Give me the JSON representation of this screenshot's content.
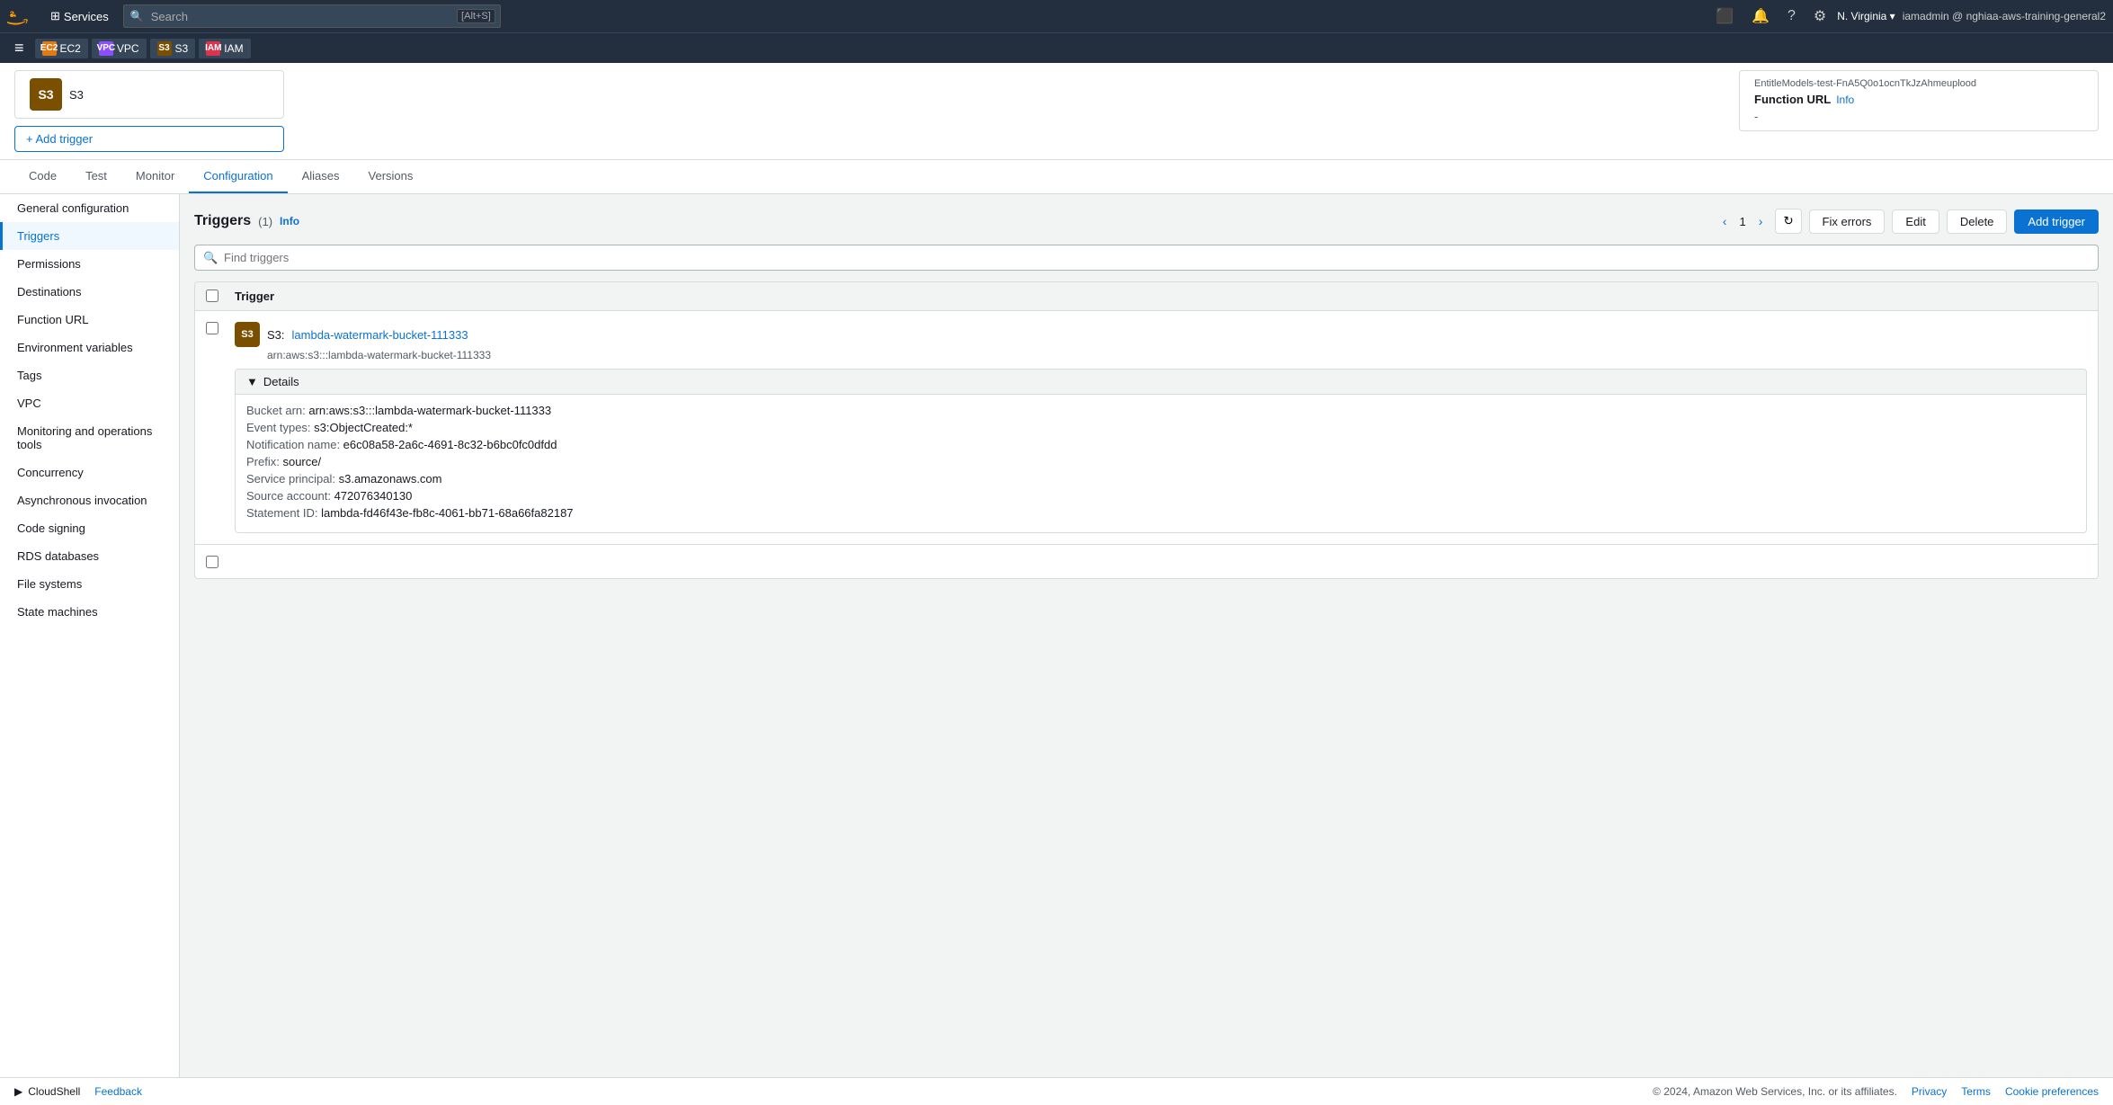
{
  "topNav": {
    "searchPlaceholder": "Search",
    "searchShortcut": "[Alt+S]",
    "servicesLabel": "Services",
    "userRegion": "N. Virginia",
    "userAccount": "iamadmin @ nghiaa-aws-training-general2"
  },
  "serviceBar": {
    "chips": [
      {
        "label": "EC2",
        "color": "#e47911"
      },
      {
        "label": "VPC",
        "color": "#8c4fff"
      },
      {
        "label": "S3",
        "color": "#7b4f00"
      },
      {
        "label": "IAM",
        "color": "#dd344c"
      }
    ]
  },
  "topPanel": {
    "s3Label": "S3",
    "addTriggerBtn": "+ Add trigger",
    "functionUrlLabel": "Function URL",
    "functionUrlInfo": "Info",
    "functionUrlValue": "-",
    "truncatedText": "EntitleModels-test-FnA5Q0o1ocnTkJzAhmeuplood"
  },
  "tabs": [
    {
      "label": "Code",
      "active": false
    },
    {
      "label": "Test",
      "active": false
    },
    {
      "label": "Monitor",
      "active": false
    },
    {
      "label": "Configuration",
      "active": true
    },
    {
      "label": "Aliases",
      "active": false
    },
    {
      "label": "Versions",
      "active": false
    }
  ],
  "sidebar": {
    "items": [
      {
        "label": "General configuration",
        "active": false
      },
      {
        "label": "Triggers",
        "active": true
      },
      {
        "label": "Permissions",
        "active": false
      },
      {
        "label": "Destinations",
        "active": false
      },
      {
        "label": "Function URL",
        "active": false
      },
      {
        "label": "Environment variables",
        "active": false
      },
      {
        "label": "Tags",
        "active": false
      },
      {
        "label": "VPC",
        "active": false
      },
      {
        "label": "Monitoring and operations tools",
        "active": false
      },
      {
        "label": "Concurrency",
        "active": false
      },
      {
        "label": "Asynchronous invocation",
        "active": false
      },
      {
        "label": "Code signing",
        "active": false
      },
      {
        "label": "RDS databases",
        "active": false
      },
      {
        "label": "File systems",
        "active": false
      },
      {
        "label": "State machines",
        "active": false
      }
    ]
  },
  "triggersSection": {
    "title": "Triggers",
    "count": "(1)",
    "infoLabel": "Info",
    "searchPlaceholder": "Find triggers",
    "tableHeader": "Trigger",
    "refreshBtn": "↻",
    "fixErrorsBtn": "Fix errors",
    "editBtn": "Edit",
    "deleteBtn": "Delete",
    "addTriggerBtn": "Add trigger",
    "pageNum": "1",
    "trigger": {
      "prefix": "S3:",
      "name": "lambda-watermark-bucket-111333",
      "arn": "arn:aws:s3:::lambda-watermark-bucket-111333",
      "details": {
        "bucketArn": "arn:aws:s3:::lambda-watermark-bucket-111333",
        "eventTypes": "s3:ObjectCreated:*",
        "notificationName": "e6c08a58-2a6c-4691-8c32-b6bc0fc0dfdd",
        "prefix": "source/",
        "servicePrincipal": "s3.amazonaws.com",
        "sourceAccount": "472076340130",
        "statementId": "lambda-fd46f43e-fb8c-4061-bb71-68a66fa82187"
      }
    }
  },
  "footer": {
    "cloudshellLabel": "CloudShell",
    "feedbackLabel": "Feedback",
    "copyright": "© 2024, Amazon Web Services, Inc. or its affiliates.",
    "links": [
      "Privacy",
      "Terms",
      "Cookie preferences"
    ]
  }
}
